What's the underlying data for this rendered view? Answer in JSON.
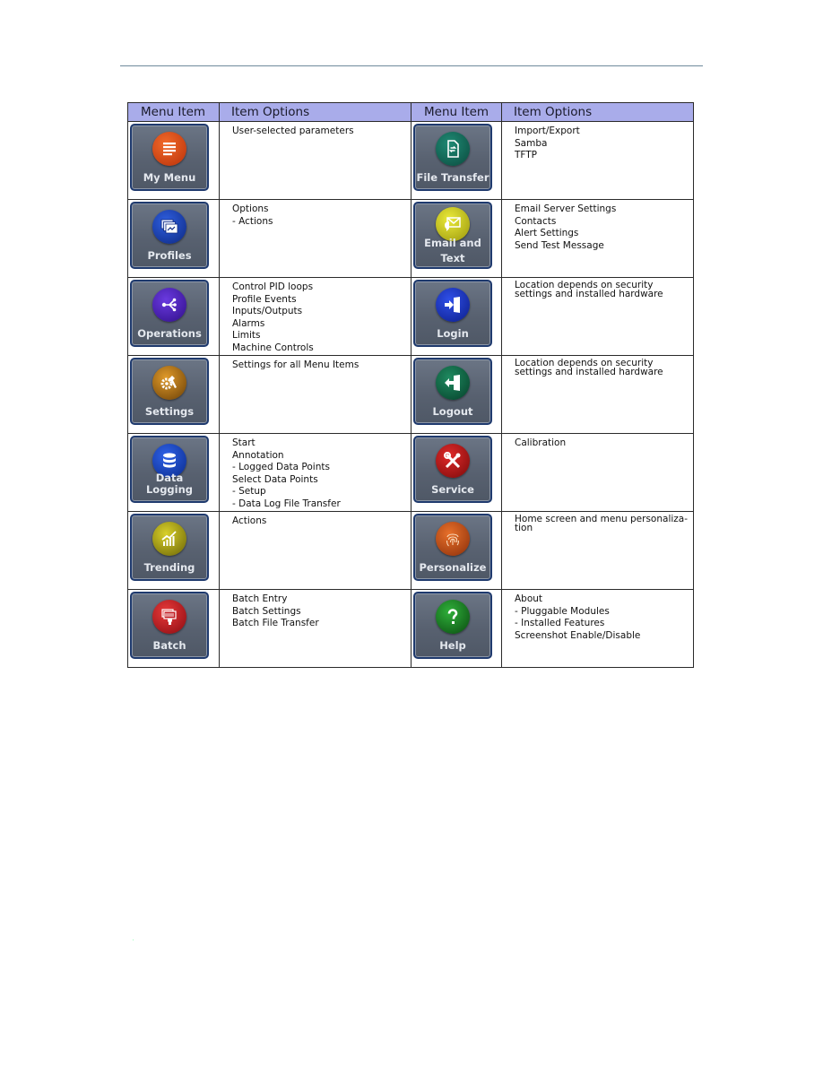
{
  "table": {
    "headers": [
      "Menu Item",
      "Item Options",
      "Menu Item",
      "Item Options"
    ],
    "rows": [
      {
        "left": {
          "label": "My Menu",
          "icon": "list-icon",
          "color": "#d2410f",
          "options": [
            "User-selected parameters"
          ]
        },
        "right": {
          "label": "File Transfer",
          "icon": "file-transfer-icon",
          "color": "#0e5e50",
          "options": [
            "Import/Export",
            "Samba",
            "TFTP"
          ]
        }
      },
      {
        "left": {
          "label": "Profiles",
          "icon": "profiles-icon",
          "color": "#1f3fb0",
          "options": [
            "Options",
            "- Actions"
          ]
        },
        "right": {
          "label_line1": "Email and",
          "label_line2": "Text",
          "icon": "email-text-icon",
          "color": "#c6c21a",
          "options": [
            "Email Server Settings",
            "Contacts",
            "Alert Settings",
            "Send Test Message"
          ]
        }
      },
      {
        "left": {
          "label": "Operations",
          "icon": "operations-icon",
          "color": "#4b1fb0",
          "options": [
            "Control PID loops",
            "Profile Events",
            "Inputs/Outputs",
            "Alarms",
            "Limits",
            "Machine Controls"
          ]
        },
        "right": {
          "label": "Login",
          "icon": "login-icon",
          "color": "#1f36b8",
          "options": [
            "Location depends on security settings and installed hardware"
          ]
        }
      },
      {
        "left": {
          "label": "Settings",
          "icon": "settings-gears-icon",
          "color": "#b77a12",
          "options": [
            "Settings for all Menu Items"
          ]
        },
        "right": {
          "label": "Logout",
          "icon": "logout-icon",
          "color": "#0e6a4a",
          "options": [
            "Location depends on security settings and installed hardware"
          ]
        }
      },
      {
        "left": {
          "label": "Data Logging",
          "icon": "database-icon",
          "color": "#1746b8",
          "options": [
            "Start",
            "Annotation",
            "- Logged Data Points",
            "Select Data Points",
            "- Setup",
            "- Data Log File Transfer"
          ]
        },
        "right": {
          "label": "Service",
          "icon": "service-tools-icon",
          "color": "#b5121b",
          "options": [
            "Calibration"
          ]
        }
      },
      {
        "left": {
          "label": "Trending",
          "icon": "trending-chart-icon",
          "color": "#a7a011",
          "options": [
            "Actions"
          ]
        },
        "right": {
          "label": "Personalize",
          "icon": "fingerprint-icon",
          "color": "#c3521e",
          "options": [
            "Home screen and menu personaliza-tion"
          ]
        }
      },
      {
        "left": {
          "label": "Batch",
          "icon": "batch-icon",
          "color": "#c11b22",
          "options": [
            "Batch Entry",
            "Batch Settings",
            "Batch File Transfer"
          ]
        },
        "right": {
          "label": "Help",
          "icon": "help-icon",
          "color": "#1c8a24",
          "options": [
            "About",
            "- Pluggable Modules",
            "- Installed Features",
            "Screenshot Enable/Disable"
          ]
        }
      }
    ]
  }
}
